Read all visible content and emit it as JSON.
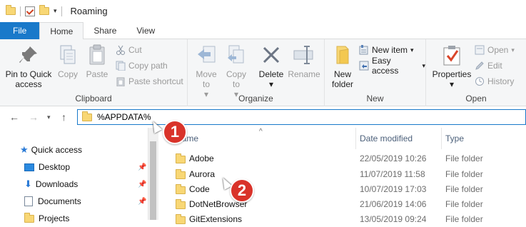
{
  "window": {
    "title": "Roaming"
  },
  "tabs": {
    "file": "File",
    "home": "Home",
    "share": "Share",
    "view": "View"
  },
  "ribbon": {
    "clipboard": {
      "label": "Clipboard",
      "pin": "Pin to Quick access",
      "copy": "Copy",
      "paste": "Paste",
      "cut": "Cut",
      "copy_path": "Copy path",
      "paste_shortcut": "Paste shortcut"
    },
    "organize": {
      "label": "Organize",
      "move_to": "Move to",
      "copy_to": "Copy to",
      "delete": "Delete",
      "rename": "Rename"
    },
    "new": {
      "label": "New",
      "new_folder": "New folder",
      "new_item": "New item",
      "easy_access": "Easy access"
    },
    "open": {
      "label": "Open",
      "properties": "Properties",
      "open": "Open",
      "edit": "Edit",
      "history": "History"
    }
  },
  "address": {
    "value": "%APPDATA%"
  },
  "nav_pane": {
    "items": [
      {
        "label": "Quick access",
        "icon": "star-icon"
      },
      {
        "label": "Desktop",
        "icon": "desktop-icon"
      },
      {
        "label": "Downloads",
        "icon": "download-icon"
      },
      {
        "label": "Documents",
        "icon": "documents-icon"
      },
      {
        "label": "Projects",
        "icon": "folder-icon"
      }
    ]
  },
  "columns": {
    "name": "Name",
    "date": "Date modified",
    "type": "Type"
  },
  "files": [
    {
      "name": "Adobe",
      "date": "22/05/2019 10:26",
      "type": "File folder"
    },
    {
      "name": "Aurora",
      "date": "11/07/2019 11:58",
      "type": "File folder"
    },
    {
      "name": "Code",
      "date": "10/07/2019 17:03",
      "type": "File folder"
    },
    {
      "name": "DotNetBrowser",
      "date": "21/06/2019 14:06",
      "type": "File folder"
    },
    {
      "name": "GitExtensions",
      "date": "13/05/2019 09:24",
      "type": "File folder"
    }
  ],
  "annotations": {
    "step1": "1",
    "step2": "2"
  },
  "colors": {
    "accent": "#1979ca",
    "badge": "#d9332a",
    "folder": "#f8d775"
  }
}
